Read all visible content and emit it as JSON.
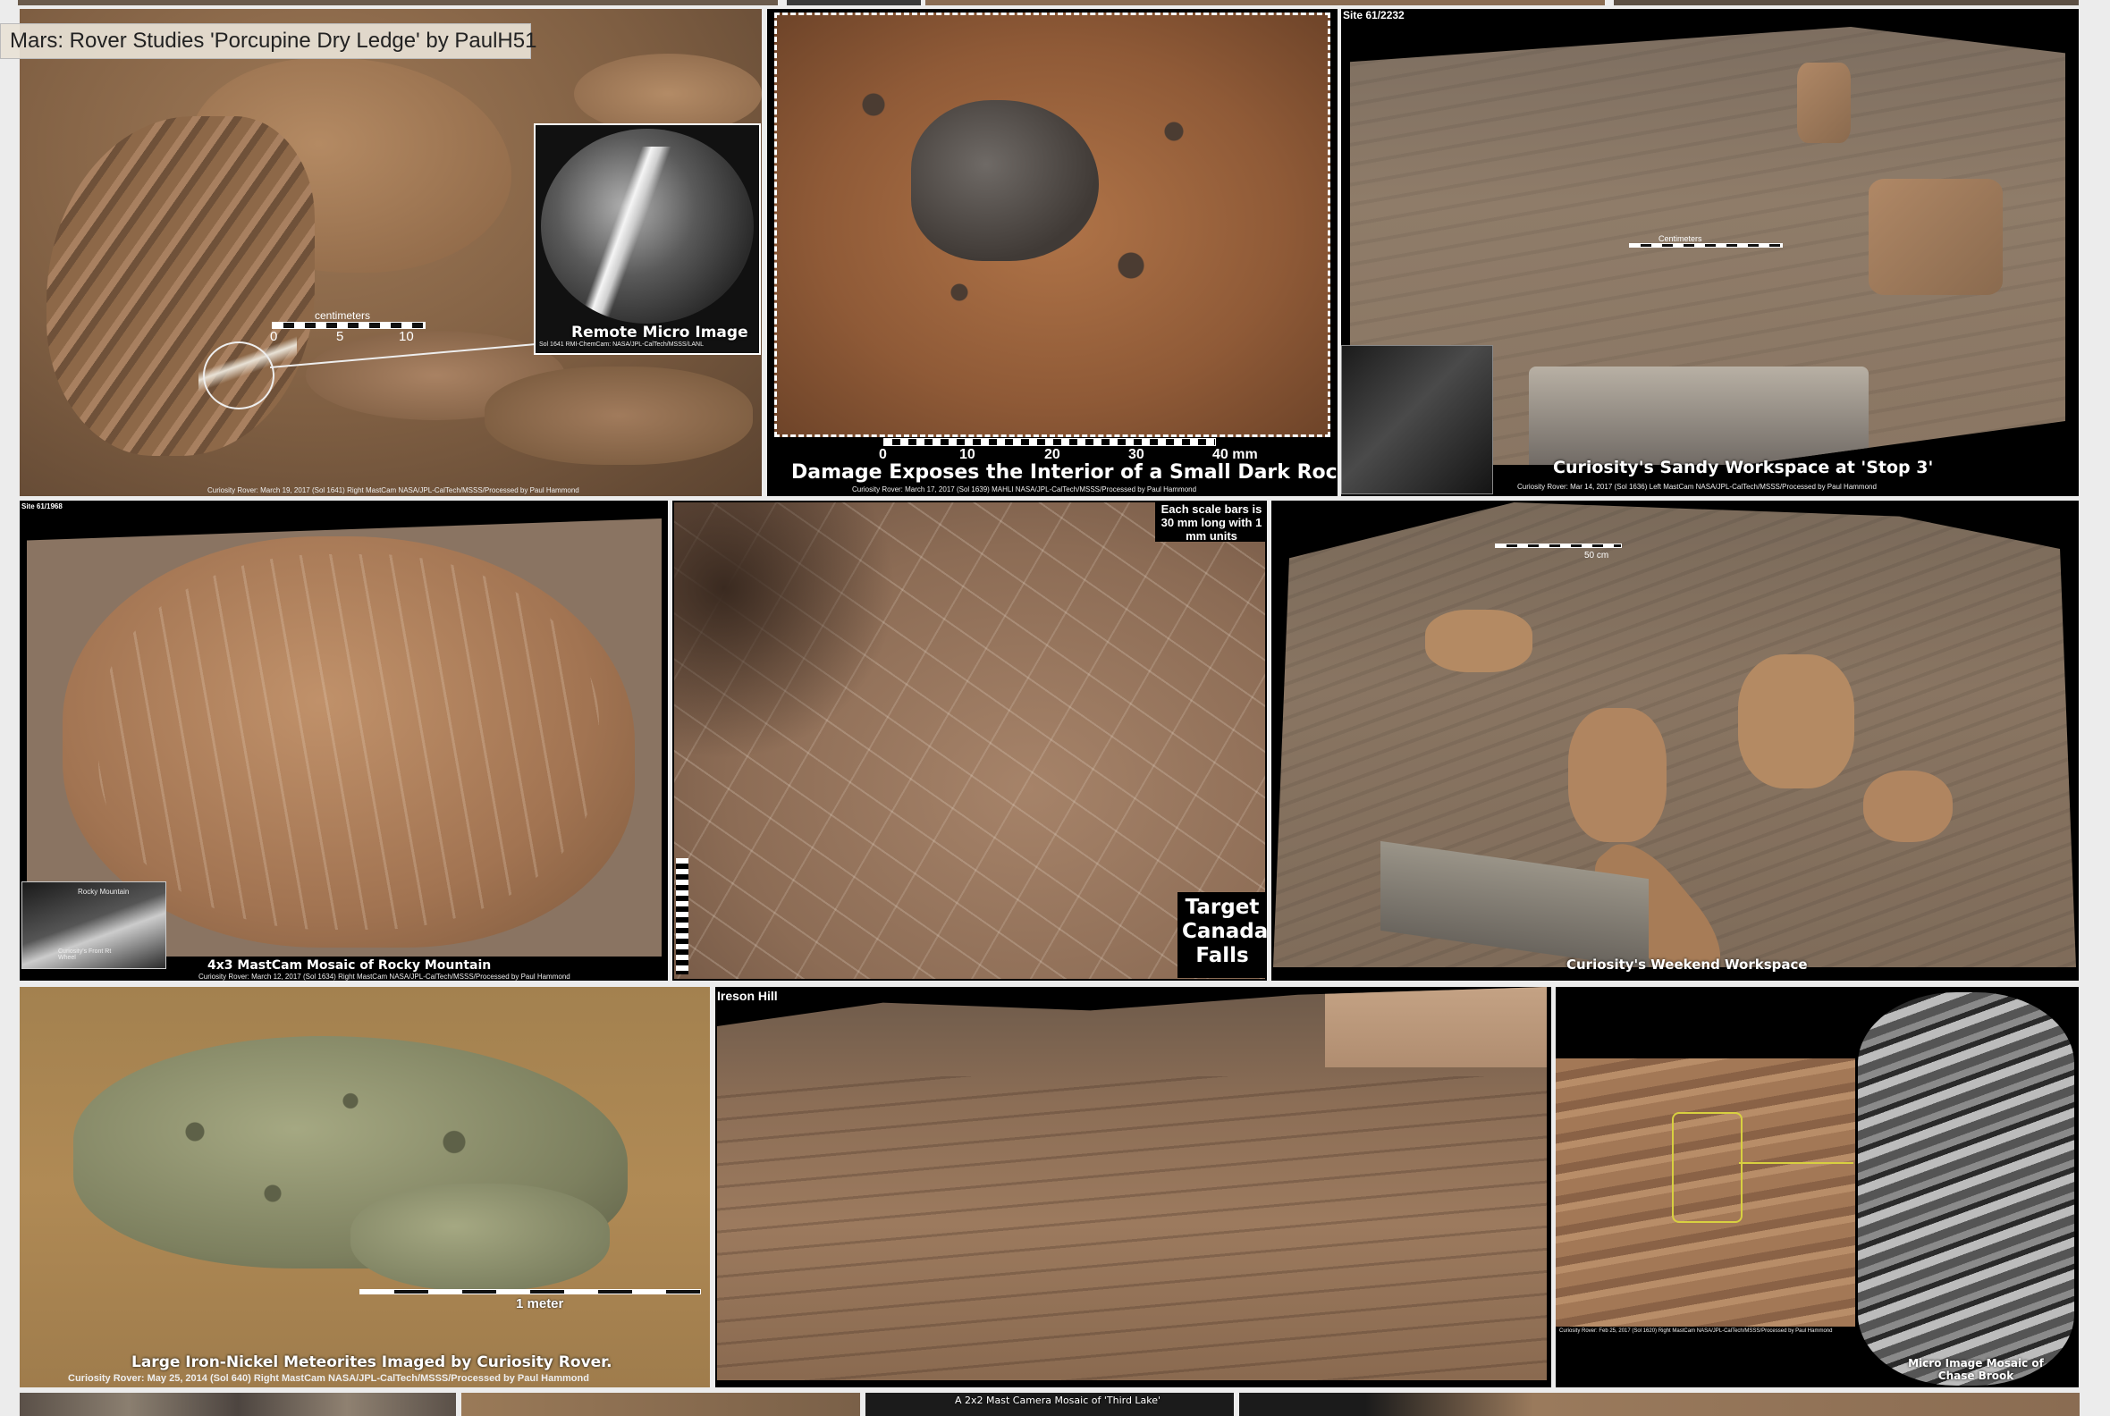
{
  "tooltip": "Mars: Rover Studies 'Porcupine Dry Ledge' by PaulH51",
  "tiles": {
    "t1": {
      "inset_title": "Remote Micro Image",
      "inset_credit": "Sol 1641 RMI-ChemCam: NASA/JPL-CalTech/MSSS/LANL",
      "scale_unit": "centimeters",
      "scale_ticks": [
        "0",
        "5",
        "10"
      ],
      "credit": "Curiosity Rover: March 19, 2017 (Sol 1641) Right MastCam NASA/JPL-CalTech/MSSS/Processed by Paul Hammond"
    },
    "t2": {
      "title": "Damage Exposes the Interior of a Small Dark Rock",
      "scale_ticks": [
        "0",
        "10",
        "20",
        "30",
        "40 mm"
      ],
      "credit": "Curiosity Rover: March 17, 2017 (Sol 1639) MAHLI NASA/JPL-CalTech/MSSS/Processed by Paul Hammond"
    },
    "t3": {
      "site": "Site 61/2232",
      "scale_unit": "Centimeters",
      "title": "Curiosity's Sandy Workspace at 'Stop 3'",
      "credit": "Curiosity Rover: Mar 14, 2017 (Sol 1636) Left MastCam NASA/JPL-CalTech/MSSS/Processed by Paul Hammond"
    },
    "t4": {
      "site": "Site 61/1968",
      "title": "4x3 MastCam Mosaic of Rocky Mountain",
      "inset_label": "Rocky Mountain",
      "inset_label2": "Curiosity's Front Rt Wheel",
      "credit": "Curiosity Rover: March 12, 2017 (Sol 1634) Right MastCam NASA/JPL-CalTech/MSSS/Processed by Paul Hammond"
    },
    "t5": {
      "scale_note": "Each scale bars is 30 mm long with 1 mm units",
      "target": "Target Canada Falls"
    },
    "t6": {
      "scale_label": "50 cm",
      "title": "Curiosity's Weekend Workspace"
    },
    "t7": {
      "scale_label": "1 meter",
      "title": "Large Iron-Nickel Meteorites Imaged by Curiosity Rover.",
      "credit": "Curiosity Rover: May 25, 2014 (Sol 640) Right MastCam NASA/JPL-CalTech/MSSS/Processed by Paul Hammond"
    },
    "t8": {
      "title": "Ireson Hill"
    },
    "t9": {
      "inset_title": "Micro Image Mosaic of Chase Brook",
      "credit": "Curiosity Rover: Feb 25, 2017 (Sol 1620) Right MastCam NASA/JPL-CalTech/MSSS/Processed by Paul Hammond"
    },
    "t12": {
      "title": "A 2x2 Mast Camera Mosaic of 'Third Lake'"
    }
  },
  "colors": {
    "page_bg": "#ececec",
    "mars_tan": "#a67c57",
    "sand": "#8a7661",
    "meteor_green": "#8f9470"
  }
}
